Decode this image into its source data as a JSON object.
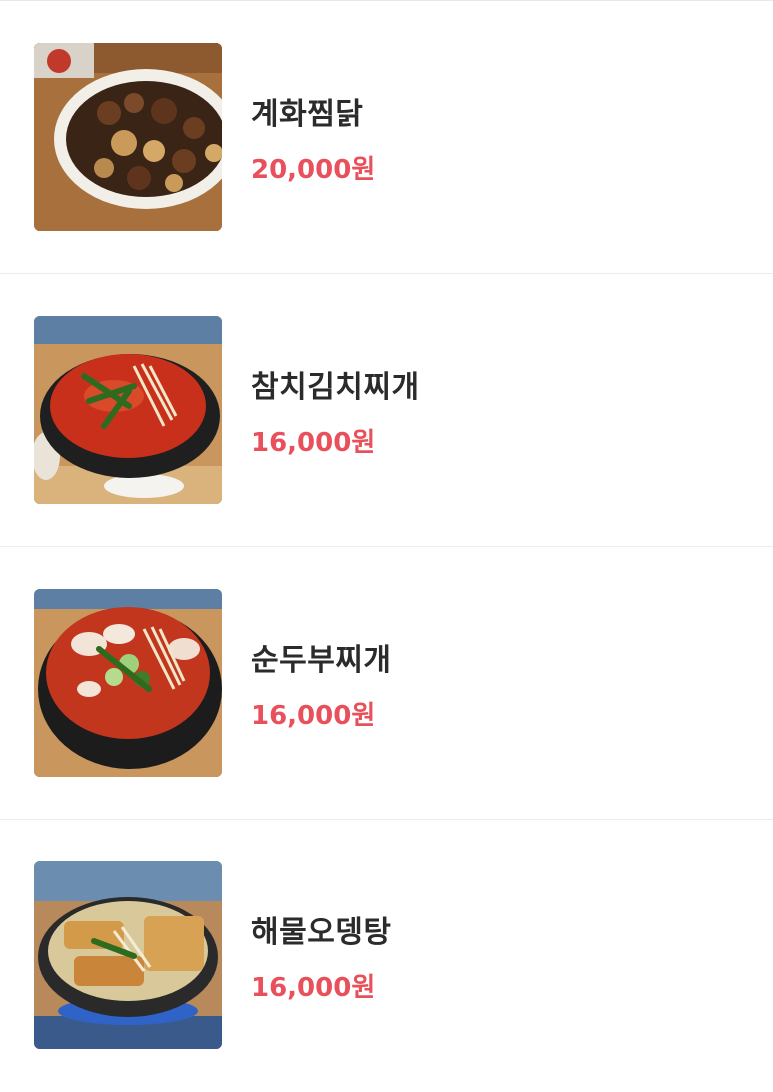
{
  "menu": {
    "items": [
      {
        "name": "계화찜닭",
        "price": "20,000원",
        "image_icon": "jjimdak-photo"
      },
      {
        "name": "참치김치찌개",
        "price": "16,000원",
        "image_icon": "kimchi-jjigae-photo"
      },
      {
        "name": "순두부찌개",
        "price": "16,000원",
        "image_icon": "sundubu-jjigae-photo"
      },
      {
        "name": "해물오뎅탕",
        "price": "16,000원",
        "image_icon": "odeng-tang-photo"
      }
    ]
  },
  "colors": {
    "price": "#e8505b",
    "name": "#2b2b2b",
    "divider": "#ececec"
  }
}
